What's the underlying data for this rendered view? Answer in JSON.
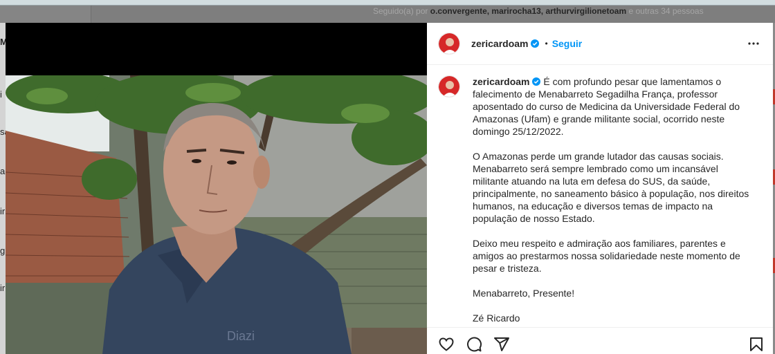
{
  "background": {
    "followed_by_prefix": "Seguido(a) por",
    "followed_by_users": "o.convergente, marirocha13, arthurvirgilionetoam",
    "followed_by_suffix": "e outras 34 pessoas",
    "left_glyphs": [
      "M",
      "i",
      "sa",
      "ar",
      "ir",
      "g",
      "ir"
    ]
  },
  "post": {
    "username": "zericardoam",
    "verified": true,
    "dot": "•",
    "follow_label": "Seguir",
    "caption": {
      "author": "zericardoam",
      "paragraphs": [
        "É com profundo pesar que lamentamos o falecimento de Menabarreto Segadilha França, professor aposentado do curso de Medicina da Universidade Federal do Amazonas (Ufam) e grande militante social, ocorrido neste domingo 25/12/2022.",
        "O Amazonas perde um grande lutador das causas sociais. Menabarreto será sempre lembrado como um incansável militante atuando na luta em defesa do SUS, da saúde, principalmente, no saneamento básico à população, nos direitos humanos, na educação e diversos temas de impacto na população de nosso Estado.",
        "Deixo meu respeito e admiração aos familiares, parentes e amigos ao prestarmos nossa solidariedade neste momento de pesar e tristeza.",
        "Menabarreto, Presente!",
        "Zé Ricardo"
      ]
    },
    "photo_shirt_text": "Diazi"
  },
  "icons": {
    "more": "more-horizontal-icon",
    "like": "heart-icon",
    "comment": "comment-icon",
    "share": "send-icon",
    "save": "bookmark-icon"
  },
  "colors": {
    "follow": "#0095f6",
    "verified": "#0095f6",
    "avatar_red": "#d62828"
  }
}
